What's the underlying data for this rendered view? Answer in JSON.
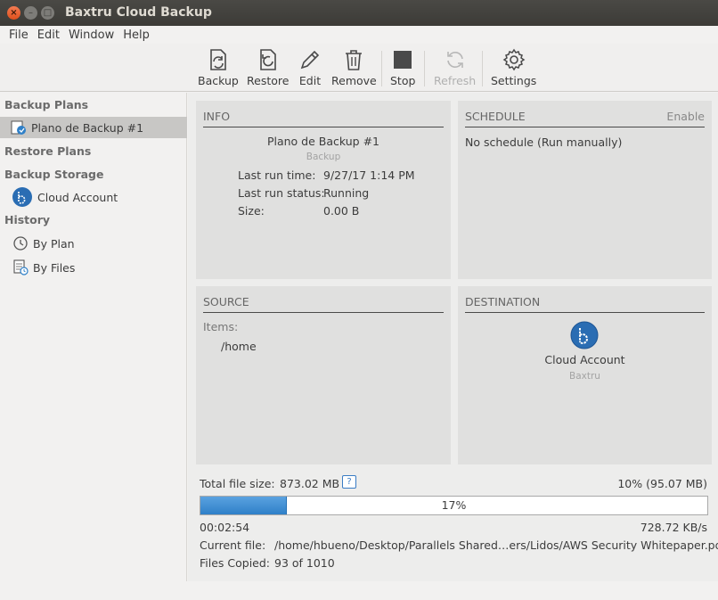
{
  "window": {
    "title": "Baxtru Cloud Backup",
    "close": "×",
    "minimize": "–",
    "maximize": "□"
  },
  "menu": [
    "File",
    "Edit",
    "Window",
    "Help"
  ],
  "toolbar": {
    "backup": "Backup",
    "restore": "Restore",
    "edit": "Edit",
    "remove": "Remove",
    "stop": "Stop",
    "refresh": "Refresh",
    "settings": "Settings"
  },
  "sidebar": {
    "backup_plans": "Backup Plans",
    "plan_item": "Plano de Backup #1",
    "restore_plans": "Restore Plans",
    "backup_storage": "Backup Storage",
    "cloud_account": "Cloud Account",
    "history": "History",
    "by_plan": "By Plan",
    "by_files": "By Files"
  },
  "info": {
    "title": "INFO",
    "plan_name": "Plano de Backup #1",
    "plan_type": "Backup",
    "last_run_time_label": "Last run time:",
    "last_run_time": "9/27/17 1:14 PM",
    "last_run_status_label": "Last run status:",
    "last_run_status": "Running",
    "size_label": "Size:",
    "size": "0.00 B"
  },
  "schedule": {
    "title": "SCHEDULE",
    "enable": "Enable",
    "text": "No schedule (Run manually)"
  },
  "source": {
    "title": "SOURCE",
    "items_label": "Items:",
    "item": "/home"
  },
  "destination": {
    "title": "DESTINATION",
    "name": "Cloud Account",
    "provider": "Baxtru"
  },
  "status": {
    "total_label": "Total file size:",
    "total_value": "873.02 MB",
    "help_icon": "?",
    "done": "10% (95.07 MB)",
    "progress_text": "17%",
    "progress_value": 0.17,
    "elapsed": "00:02:54",
    "speed": "728.72 KB/s",
    "current_file_label": "Current file:",
    "current_file": "/home/hbueno/Desktop/Parallels Shared…ers/Lidos/AWS Security Whitepaper.pdf",
    "files_copied_label": "Files Copied:",
    "files_copied": "93 of 1010"
  },
  "colors": {
    "accent": "#2f80c8",
    "title_bar": "#3c3b37",
    "close": "#e0501c"
  }
}
